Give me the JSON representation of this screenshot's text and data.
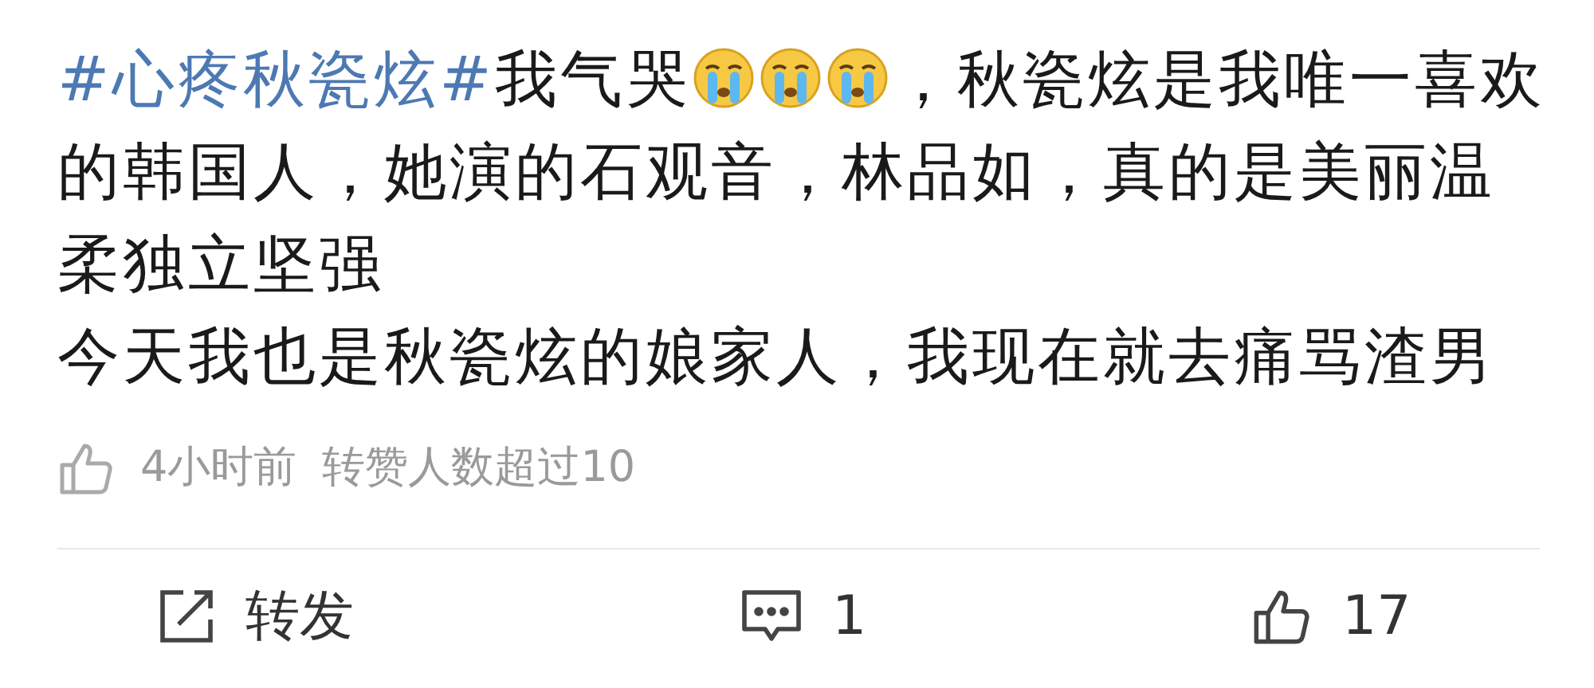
{
  "post": {
    "hashtag": "#心疼秋瓷炫#",
    "text_before": "我气哭",
    "emojis": [
      {
        "kind": "crying"
      },
      {
        "kind": "crying"
      },
      {
        "kind": "crying"
      }
    ],
    "text_after": "，秋瓷炫是我唯一喜欢的韩国人，她演的石观音，林品如，真的是美丽温柔独立坚强",
    "paragraph_2": "今天我也是秋瓷炫的娘家人，我现在就去痛骂渣男"
  },
  "meta": {
    "time": "4小时前",
    "note": "转赞人数超过10"
  },
  "actions": [
    {
      "kind": "repost",
      "label": "转发"
    },
    {
      "kind": "comment",
      "label": "1"
    },
    {
      "kind": "like",
      "label": "17"
    }
  ]
}
